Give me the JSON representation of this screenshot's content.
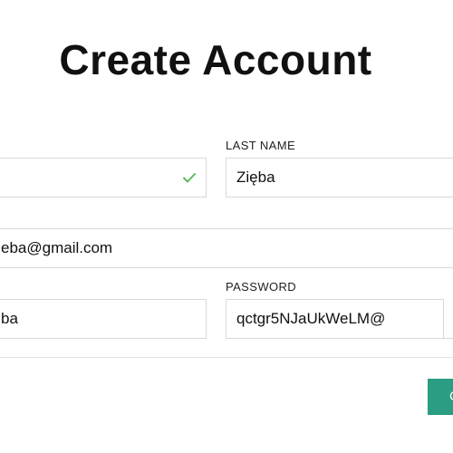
{
  "page": {
    "title": "Create Account"
  },
  "form": {
    "first_name": {
      "value": ""
    },
    "last_name": {
      "label": "LAST NAME",
      "value": "Zięba"
    },
    "email": {
      "value": "eba@gmail.com"
    },
    "username": {
      "value": "ba"
    },
    "password": {
      "label": "PASSWORD",
      "value": "qctgr5NJaUkWeLM@"
    },
    "submit": {
      "label": "C"
    }
  },
  "colors": {
    "accent": "#2a9d82",
    "valid_check": "#5cb85c",
    "border": "#d9d9d9"
  }
}
